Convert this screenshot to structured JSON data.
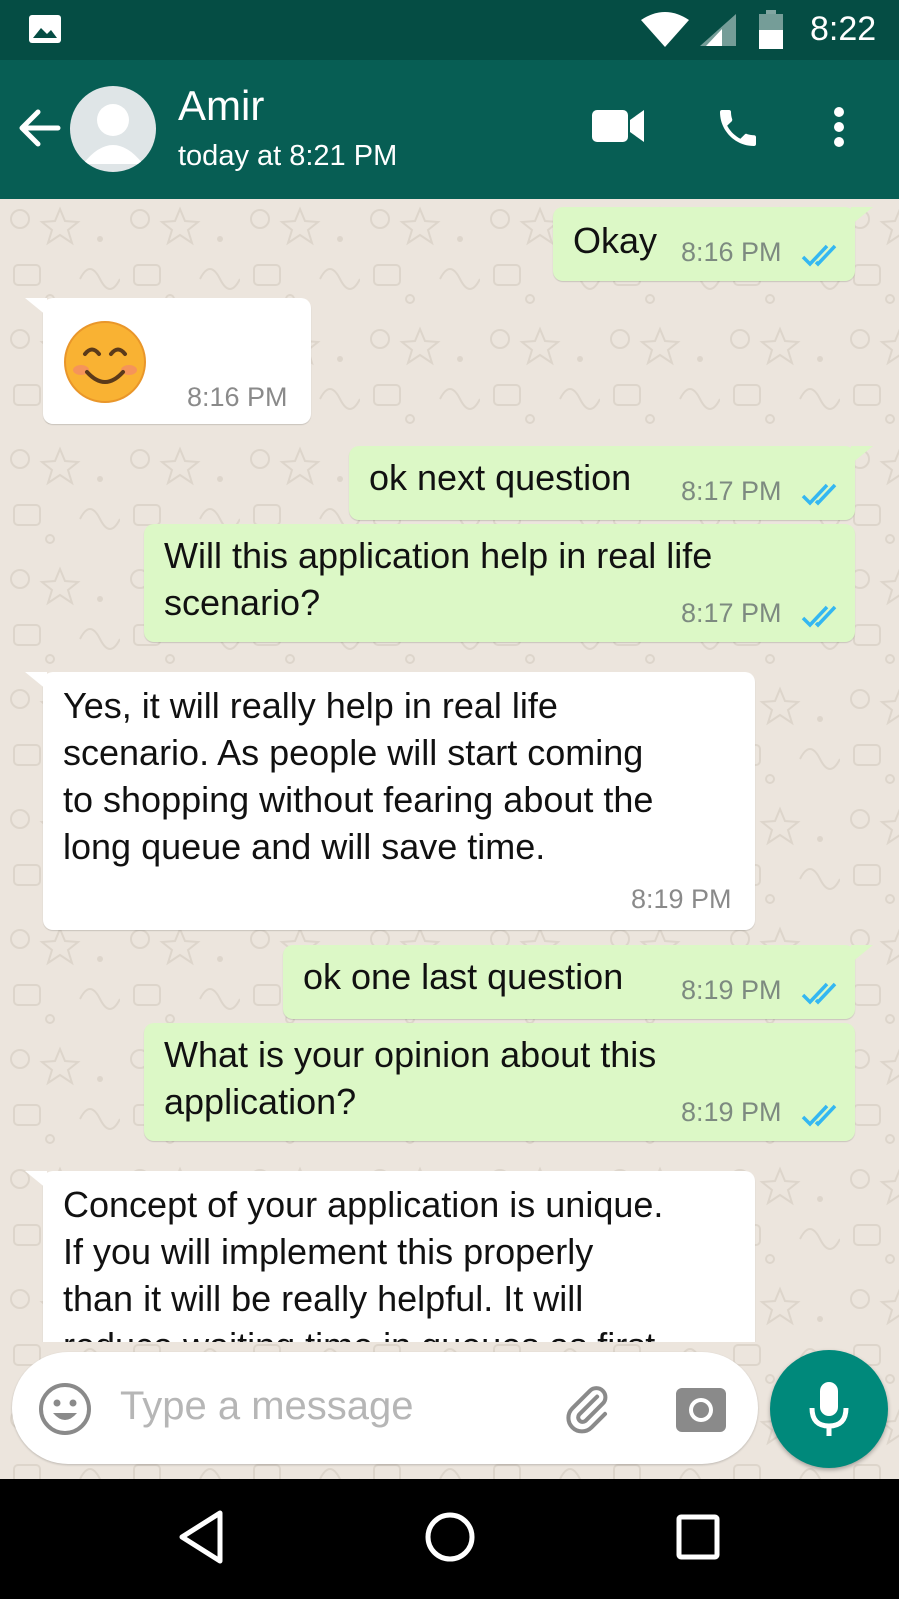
{
  "status_bar": {
    "time": "8:22"
  },
  "header": {
    "contact_name": "Amir",
    "last_seen": "today at 8:21 PM"
  },
  "messages": [
    {
      "direction": "outgoing",
      "lines": [
        "Okay"
      ],
      "time": "8:16 PM",
      "status": "read"
    },
    {
      "direction": "incoming",
      "lines": [],
      "emoji": "smiling-face-with-smiling-eyes",
      "time": "8:16 PM"
    },
    {
      "direction": "outgoing",
      "lines": [
        "ok next question"
      ],
      "time": "8:17 PM",
      "status": "read"
    },
    {
      "direction": "outgoing",
      "lines": [
        "Will this application help in real life",
        "scenario?"
      ],
      "time": "8:17 PM",
      "status": "read"
    },
    {
      "direction": "incoming",
      "lines": [
        "Yes, it will really help in real life",
        "scenario. As people will start coming",
        "to shopping without fearing about the",
        "long queue and will save time."
      ],
      "time": "8:19 PM"
    },
    {
      "direction": "outgoing",
      "lines": [
        "ok one last question"
      ],
      "time": "8:19 PM",
      "status": "read"
    },
    {
      "direction": "outgoing",
      "lines": [
        "What is your opinion about this",
        "application?"
      ],
      "time": "8:19 PM",
      "status": "read"
    },
    {
      "direction": "incoming",
      "lines": [
        "Concept of your application is unique.",
        "If you will implement this properly",
        "than it will be really helpful. It will",
        "reduce waiting time in queues as first"
      ],
      "time": ""
    }
  ],
  "composer": {
    "placeholder": "Type a message"
  },
  "colors": {
    "header": "#075e54",
    "status_bar": "#054d44",
    "outgoing_bubble": "#dcf8c6",
    "incoming_bubble": "#ffffff",
    "read_tick": "#34b7f1",
    "fab": "#00897b"
  }
}
